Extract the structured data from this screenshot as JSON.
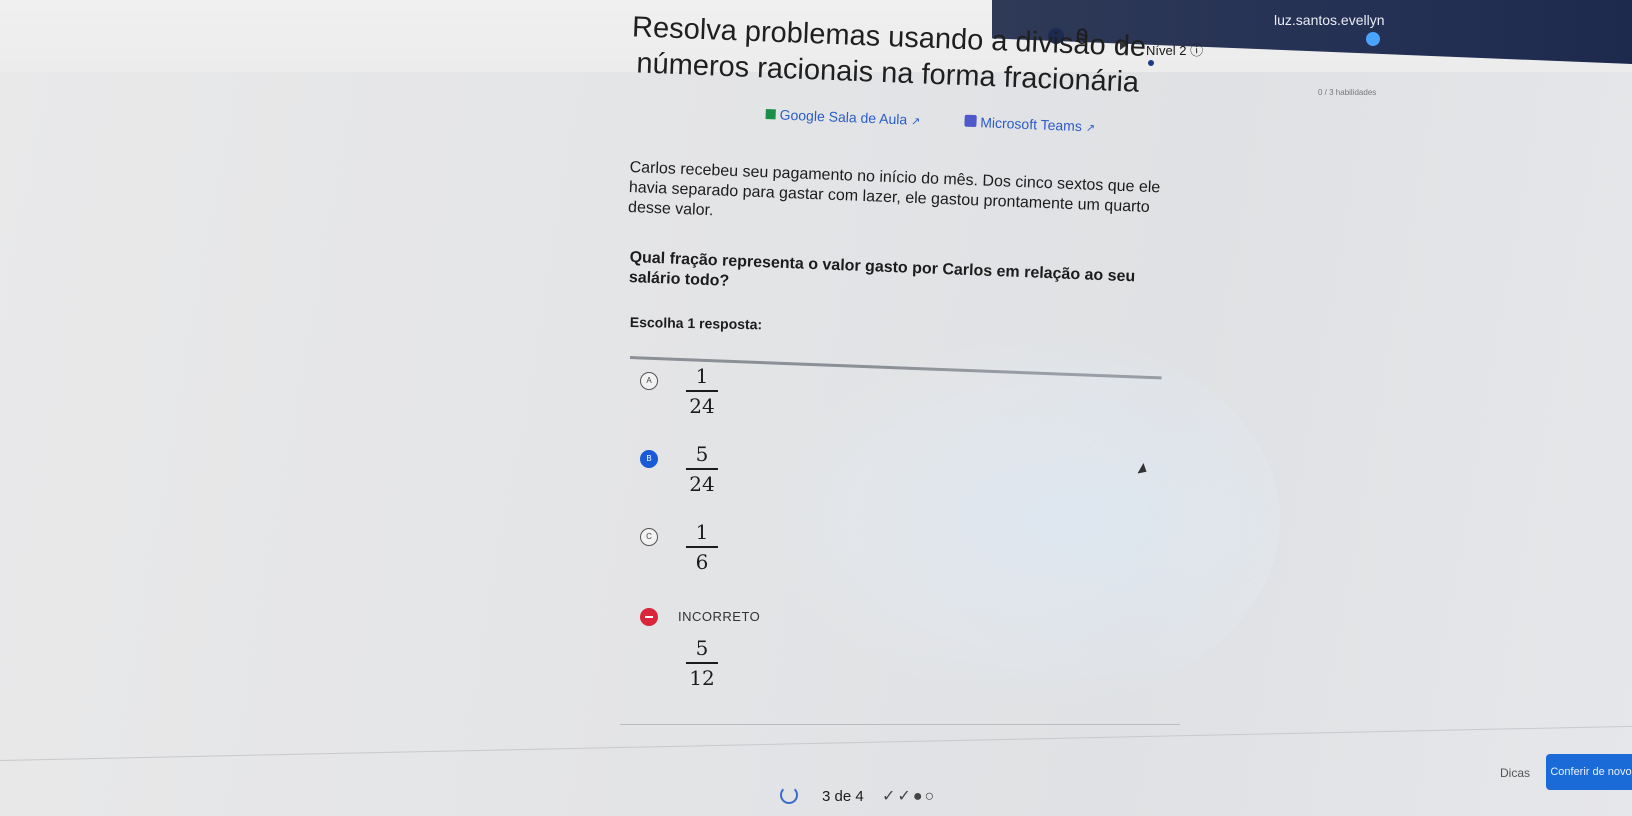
{
  "header": {
    "energy_icon": "energy-drop-icon",
    "energy_count": "0",
    "level_label": "Nível 2 ⓘ",
    "user_name": "luz.santos.evellyn",
    "badge_text": "0 / 3 habilidades"
  },
  "exercise": {
    "title": "Resolva problemas usando a divisão de números racionais na forma fracionária",
    "links": [
      {
        "label": "Google Sala de Aula",
        "icon": "google-classroom-icon"
      },
      {
        "label": "Microsoft Teams",
        "icon": "microsoft-teams-icon"
      }
    ],
    "problem_text": "Carlos recebeu seu pagamento no início do mês. Dos cinco sextos que ele havia separado para gastar com lazer, ele gastou prontamente um quarto desse valor.",
    "question_text": "Qual fração representa o valor gasto por Carlos em relação ao seu salário todo?",
    "choose_label": "Escolha 1 resposta:",
    "options": [
      {
        "letter": "A",
        "numerator": "1",
        "denominator": "24",
        "selected": false
      },
      {
        "letter": "B",
        "numerator": "5",
        "denominator": "24",
        "selected": true
      },
      {
        "letter": "C",
        "numerator": "1",
        "denominator": "6",
        "selected": false
      }
    ],
    "feedback": {
      "label": "INCORRETO",
      "numerator": "5",
      "denominator": "12"
    }
  },
  "footer": {
    "progress_label": "3 de 4",
    "progress_marks": "✓✓●○",
    "hint_label": "Dicas",
    "check_label": "Conferir de novo"
  },
  "colors": {
    "accent": "#1a5ad6",
    "incorrect": "#d9263a",
    "header_dark": "#243054"
  }
}
